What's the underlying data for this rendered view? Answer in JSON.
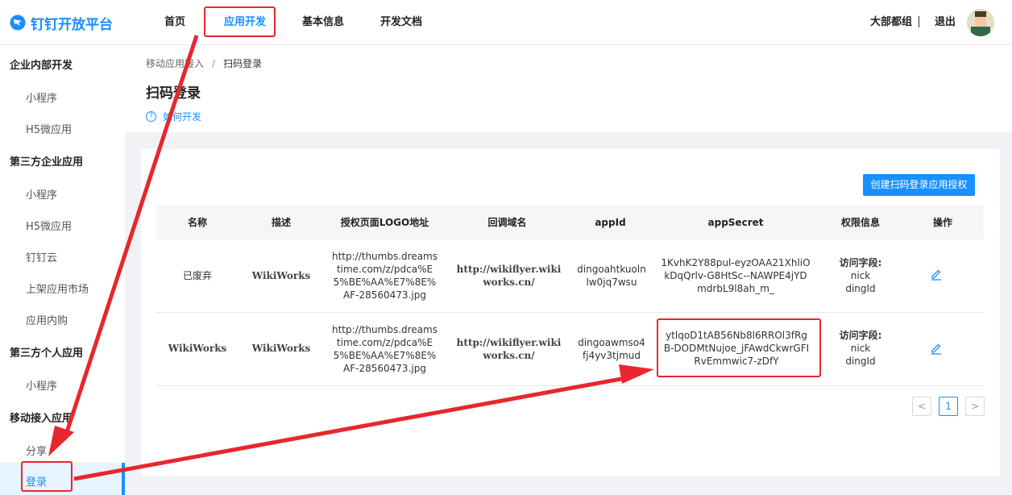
{
  "app": {
    "logo_text": "钉钉开放平台"
  },
  "topnav": {
    "items": [
      {
        "label": "首页"
      },
      {
        "label": "应用开发"
      },
      {
        "label": "基本信息"
      },
      {
        "label": "开发文档"
      }
    ],
    "active_index": 1,
    "user_name": "大部都组",
    "logout_label": "退出"
  },
  "sidebar": {
    "groups": [
      {
        "label": "企业内部开发",
        "items": [
          "小程序",
          "H5微应用"
        ]
      },
      {
        "label": "第三方企业应用",
        "items": [
          "小程序",
          "H5微应用",
          "钉钉云",
          "上架应用市场",
          "应用内购"
        ]
      },
      {
        "label": "第三方个人应用",
        "items": [
          "小程序"
        ]
      },
      {
        "label": "移动接入应用",
        "items": [
          "分享",
          "登录"
        ]
      }
    ],
    "active_item": "登录"
  },
  "breadcrumb": {
    "parent": "移动应用接入",
    "separator": "/",
    "current": "扫码登录"
  },
  "page": {
    "title": "扫码登录",
    "help_link": "如何开发",
    "help_icon": "question-circle-icon"
  },
  "toolbar": {
    "create_label": "创建扫码登录应用授权"
  },
  "table": {
    "columns": [
      "名称",
      "描述",
      "授权页面LOGO地址",
      "回调域名",
      "appId",
      "appSecret",
      "权限信息",
      "操作"
    ],
    "rows": [
      {
        "name": "已废弃",
        "description": "WikiWorks",
        "logo_url": "http://thumbs.dreamstime.com/z/pdca%E5%BE%AA%E7%8E%AF-28560473.jpg",
        "callback_domain": "http://wikiflyer.wikiworks.cn/",
        "app_id": "dingoahtkuolnlw0jq7wsu",
        "app_secret": "1KvhK2Y88pul-eyzOAA21XhliOkDqQrlv-G8HtSc--NAWPE4jYDmdrbL9l8ah_m_",
        "perm_label": "访问字段:",
        "perm_fields": [
          "nick",
          "dingId"
        ],
        "action_icon": "edit-icon"
      },
      {
        "name": "WikiWorks",
        "description": "WikiWorks",
        "logo_url": "http://thumbs.dreamstime.com/z/pdca%E5%BE%AA%E7%8E%AF-28560473.jpg",
        "callback_domain": "http://wikiflyer.wikiworks.cn/",
        "app_id": "dingoawmso4fj4yv3tjmud",
        "app_secret": "ytlqoD1tAB56Nb8l6RROl3fRgB-DODMtNujoe_jFAwdCkwrGFIRvEmmwic7-zDfY",
        "perm_label": "访问字段:",
        "perm_fields": [
          "nick",
          "dingId"
        ],
        "action_icon": "edit-icon"
      }
    ]
  },
  "pagination": {
    "prev": "<",
    "current": "1",
    "next": ">"
  },
  "colors": {
    "accent": "#1890ff",
    "annotation": "#e8262d"
  }
}
